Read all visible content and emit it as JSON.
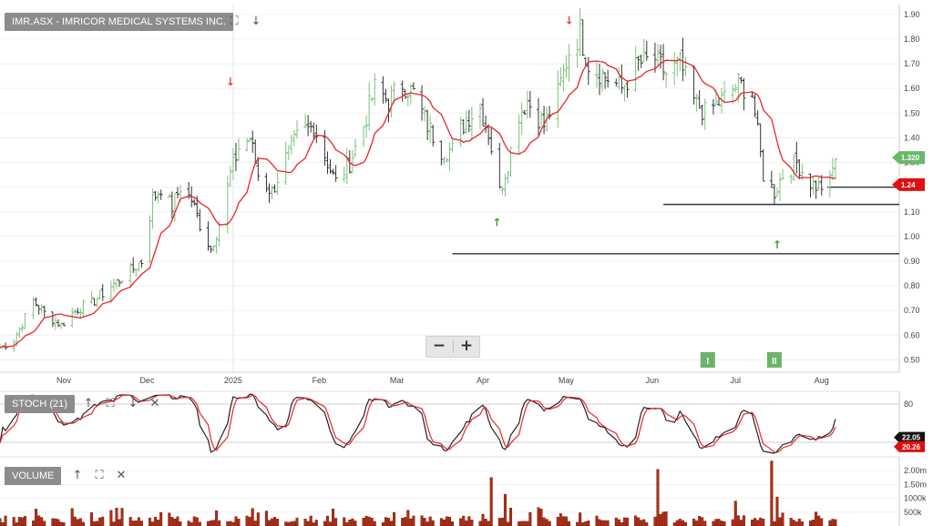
{
  "header": {
    "title": "IMR.ASX - IMRICOR MEDICAL SYSTEMS INC.",
    "expand_icon": "expand-icon",
    "down_icon": "arrow-down-icon"
  },
  "stoch_panel": {
    "label": "STOCH (21)",
    "level_label": "80",
    "last_k": "22.05",
    "last_d": "20.26"
  },
  "volume_panel": {
    "label": "VOLUME",
    "axis_labels": [
      "2.00m",
      "1.50m",
      "1000k",
      "500k"
    ]
  },
  "zoom": {
    "minus": "−",
    "plus": "+"
  },
  "markers": {
    "up_arrow": "↑",
    "down_arrow": "↓",
    "event_single": "I",
    "event_double": "II"
  },
  "colors": {
    "sma": "#e8262a",
    "bar_up": "#7cc27c",
    "bar_down": "#333333",
    "stoch_k": "#222222",
    "stoch_d": "#e8262a",
    "volume": "#b42b12",
    "last_price_tag": "#6bb86b",
    "sma_tag": "#e01010",
    "event_box": "#3b9a3b"
  },
  "chart_data": {
    "type": "ohlc",
    "y_ticks": [
      "0.50",
      "0.60",
      "0.70",
      "0.80",
      "0.90",
      "1.00",
      "1.10",
      "1.20",
      "1.30",
      "1.40",
      "1.50",
      "1.60",
      "1.70",
      "1.80",
      "1.90"
    ],
    "x_labels": [
      {
        "label": "Nov",
        "date": "2024-11-01"
      },
      {
        "label": "Dec",
        "date": "2024-12-01"
      },
      {
        "label": "2025",
        "date": "2025-01-01"
      },
      {
        "label": "Feb",
        "date": "2025-02-01"
      },
      {
        "label": "Mar",
        "date": "2025-03-01"
      },
      {
        "label": "Apr",
        "date": "2025-04-01"
      },
      {
        "label": "May",
        "date": "2025-05-01"
      },
      {
        "label": "Jun",
        "date": "2025-06-01"
      },
      {
        "label": "Jul",
        "date": "2025-07-01"
      },
      {
        "label": "Aug",
        "date": "2025-08-01"
      }
    ],
    "x_range": [
      "2024-10-09",
      "2025-08-29"
    ],
    "y_range": [
      0.45,
      1.94
    ],
    "last_price": "1.320",
    "sma_value": "1.24",
    "price_anchors": [
      [
        "2024-10-09",
        0.55
      ],
      [
        "2024-10-14",
        0.58
      ],
      [
        "2024-10-21",
        0.74
      ],
      [
        "2024-10-25",
        0.69
      ],
      [
        "2024-10-31",
        0.64
      ],
      [
        "2024-11-05",
        0.7
      ],
      [
        "2024-11-12",
        0.74
      ],
      [
        "2024-11-18",
        0.8
      ],
      [
        "2024-11-25",
        0.86
      ],
      [
        "2024-11-29",
        0.9
      ],
      [
        "2024-12-03",
        1.15
      ],
      [
        "2024-12-06",
        1.2
      ],
      [
        "2024-12-10",
        1.12
      ],
      [
        "2024-12-13",
        1.2
      ],
      [
        "2024-12-17",
        1.15
      ],
      [
        "2024-12-20",
        1.05
      ],
      [
        "2024-12-24",
        0.95
      ],
      [
        "2024-12-27",
        1.05
      ],
      [
        "2024-12-31",
        1.25
      ],
      [
        "2025-01-03",
        1.36
      ],
      [
        "2025-01-07",
        1.4
      ],
      [
        "2025-01-10",
        1.25
      ],
      [
        "2025-01-15",
        1.18
      ],
      [
        "2025-01-20",
        1.32
      ],
      [
        "2025-01-24",
        1.4
      ],
      [
        "2025-01-30",
        1.45
      ],
      [
        "2025-02-04",
        1.3
      ],
      [
        "2025-02-07",
        1.22
      ],
      [
        "2025-02-12",
        1.3
      ],
      [
        "2025-02-17",
        1.45
      ],
      [
        "2025-02-21",
        1.6
      ],
      [
        "2025-02-26",
        1.55
      ],
      [
        "2025-03-03",
        1.62
      ],
      [
        "2025-03-07",
        1.58
      ],
      [
        "2025-03-12",
        1.45
      ],
      [
        "2025-03-17",
        1.35
      ],
      [
        "2025-03-21",
        1.35
      ],
      [
        "2025-03-26",
        1.48
      ],
      [
        "2025-03-31",
        1.52
      ],
      [
        "2025-04-03",
        1.42
      ],
      [
        "2025-04-07",
        1.18
      ],
      [
        "2025-04-10",
        1.3
      ],
      [
        "2025-04-14",
        1.5
      ],
      [
        "2025-04-17",
        1.55
      ],
      [
        "2025-04-23",
        1.45
      ],
      [
        "2025-04-28",
        1.58
      ],
      [
        "2025-05-02",
        1.75
      ],
      [
        "2025-05-06",
        1.82
      ],
      [
        "2025-05-09",
        1.7
      ],
      [
        "2025-05-15",
        1.65
      ],
      [
        "2025-05-21",
        1.6
      ],
      [
        "2025-05-27",
        1.7
      ],
      [
        "2025-06-02",
        1.72
      ],
      [
        "2025-06-06",
        1.66
      ],
      [
        "2025-06-11",
        1.7
      ],
      [
        "2025-06-16",
        1.55
      ],
      [
        "2025-06-20",
        1.5
      ],
      [
        "2025-06-26",
        1.55
      ],
      [
        "2025-07-02",
        1.62
      ],
      [
        "2025-07-07",
        1.58
      ],
      [
        "2025-07-11",
        1.25
      ],
      [
        "2025-07-15",
        1.18
      ],
      [
        "2025-07-18",
        1.25
      ],
      [
        "2025-07-23",
        1.3
      ],
      [
        "2025-07-28",
        1.22
      ],
      [
        "2025-07-31",
        1.2
      ],
      [
        "2025-08-04",
        1.22
      ],
      [
        "2025-08-06",
        1.32
      ]
    ],
    "horizontal_lines": [
      {
        "price": 0.93,
        "from": "2025-03-21",
        "to": "2025-08-29"
      },
      {
        "price": 1.13,
        "from": "2025-06-05",
        "to": "2025-08-29"
      },
      {
        "price": 1.2,
        "from": "2025-08-03",
        "to": "2025-08-29"
      }
    ],
    "up_signals": [
      {
        "date": "2025-04-06",
        "price": 1.06
      },
      {
        "date": "2025-07-16",
        "price": 0.97
      }
    ],
    "down_signals": [
      {
        "date": "2024-12-31",
        "price": 1.63
      },
      {
        "date": "2025-05-02",
        "price": 1.88
      }
    ],
    "events": [
      {
        "date": "2025-06-21",
        "kind": "single"
      },
      {
        "date": "2025-07-15",
        "kind": "double"
      }
    ],
    "stoch_range": [
      0,
      100
    ],
    "stoch_level": 80,
    "volume_range": [
      0,
      2500000
    ],
    "volume_ticks": [
      500000,
      1000000,
      1500000,
      2000000
    ],
    "volume_spikes": [
      {
        "date": "2025-04-04",
        "value": 1750000
      },
      {
        "date": "2025-04-09",
        "value": 1150000
      },
      {
        "date": "2025-06-03",
        "value": 2050000
      },
      {
        "date": "2025-07-01",
        "value": 900000
      },
      {
        "date": "2025-07-14",
        "value": 2350000
      },
      {
        "date": "2025-07-16",
        "value": 1050000
      }
    ]
  }
}
